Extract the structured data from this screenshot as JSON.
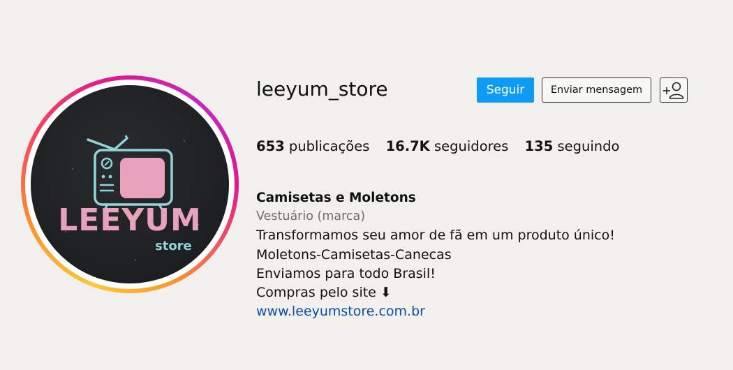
{
  "avatar": {
    "logo_title": "LEEYUM",
    "logo_subtitle": "store"
  },
  "profile": {
    "username": "leeyum_store",
    "follow_label": "Seguir",
    "message_label": "Enviar mensagem",
    "suggest_icon": "add-person-icon"
  },
  "stats": {
    "posts_count": "653",
    "posts_label": "publicações",
    "followers_count": "16.7K",
    "followers_label": "seguidores",
    "following_count": "135",
    "following_label": "seguindo"
  },
  "bio": {
    "name": "Camisetas e Moletons",
    "category": "Vestuário (marca)",
    "lines": [
      "Transformamos seu amor de fã em um produto único!",
      "Moletons-Camisetas-Canecas",
      "Enviamos para todo Brasil!",
      "Compras pelo site ⬇"
    ],
    "link": "www.leeyumstore.com.br"
  },
  "colors": {
    "background": "#f1f0ec",
    "follow_button": "#0d9bf5",
    "link": "#0a4fa3",
    "logo_pink": "#e9a2bb",
    "logo_cyan": "#8fd5d9"
  }
}
